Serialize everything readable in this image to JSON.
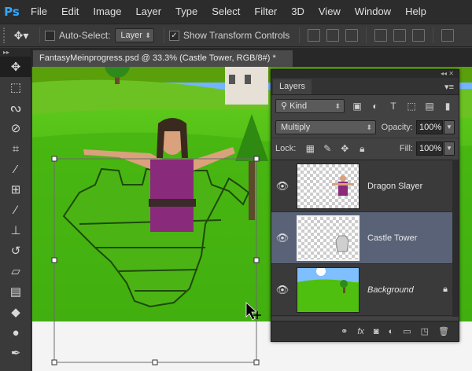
{
  "app": {
    "logo": "Ps"
  },
  "menu": [
    "File",
    "Edit",
    "Image",
    "Layer",
    "Type",
    "Select",
    "Filter",
    "3D",
    "View",
    "Window",
    "Help"
  ],
  "options": {
    "auto_select_label": "Auto-Select:",
    "auto_select_value": "Layer",
    "show_transform_label": "Show Transform Controls",
    "show_transform_checked": true
  },
  "document": {
    "tab_title": "FantasyMeinprogress.psd @ 33.3% (Castle Tower, RGB/8#) *"
  },
  "layers_panel": {
    "title": "Layers",
    "filter_kind": "Kind",
    "blend_mode": "Multiply",
    "opacity_label": "Opacity:",
    "opacity_value": "100%",
    "lock_label": "Lock:",
    "fill_label": "Fill:",
    "fill_value": "100%",
    "layers": [
      {
        "name": "Dragon Slayer",
        "selected": false,
        "italic": false,
        "locked": false
      },
      {
        "name": "Castle Tower",
        "selected": true,
        "italic": false,
        "locked": false
      },
      {
        "name": "Background",
        "selected": false,
        "italic": true,
        "locked": true
      }
    ],
    "bottom_icons": [
      "link-icon",
      "fx-icon",
      "mask-icon",
      "adjustment-icon",
      "group-icon",
      "new-layer-icon",
      "trash-icon"
    ],
    "fx_label": "fx"
  },
  "colors": {
    "accent": "#31a8ff",
    "selected_layer": "#5a6277",
    "grass": "#4fbf0f"
  }
}
